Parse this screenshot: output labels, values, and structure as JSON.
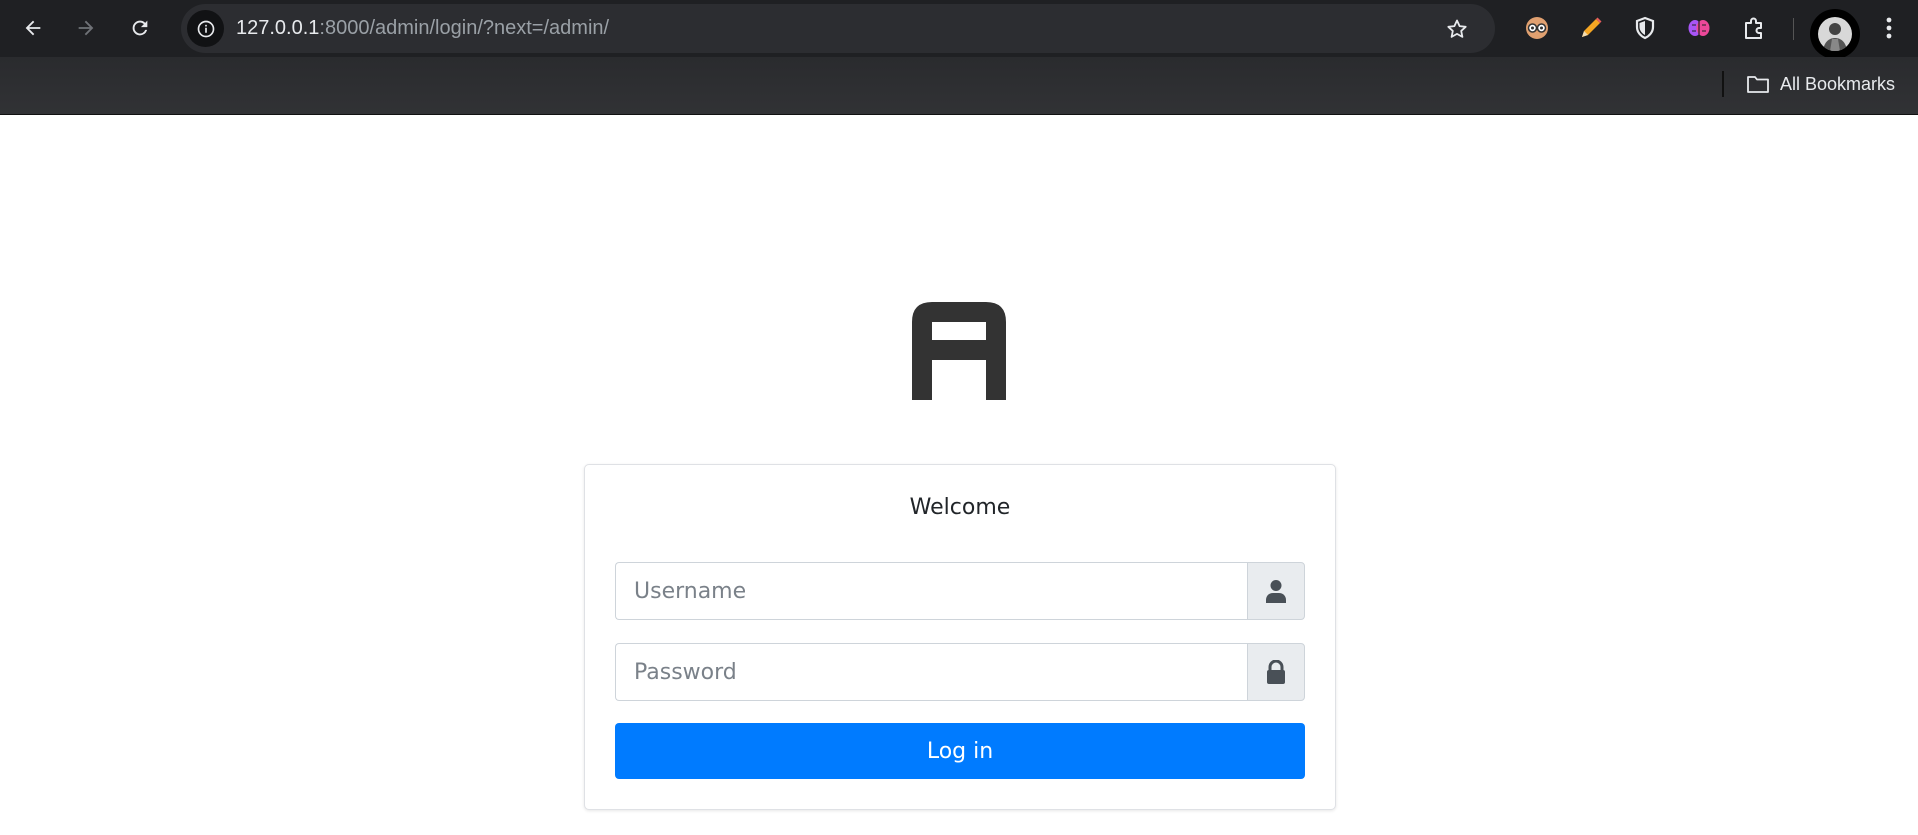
{
  "browser": {
    "url_host": "127.0.0.1",
    "url_rest": ":8000/admin/login/?next=/admin/",
    "bookmarks_label": "All Bookmarks",
    "extensions": [
      "glasses-extension-icon",
      "pencil-extension-icon",
      "shield-extension-icon",
      "brain-extension-icon",
      "puzzle-extensions-icon"
    ]
  },
  "login": {
    "welcome": "Welcome",
    "username_placeholder": "Username",
    "password_placeholder": "Password",
    "submit_label": "Log in"
  },
  "colors": {
    "primary": "#007bff",
    "chrome_bg": "#1f2023",
    "logo": "#333333"
  }
}
